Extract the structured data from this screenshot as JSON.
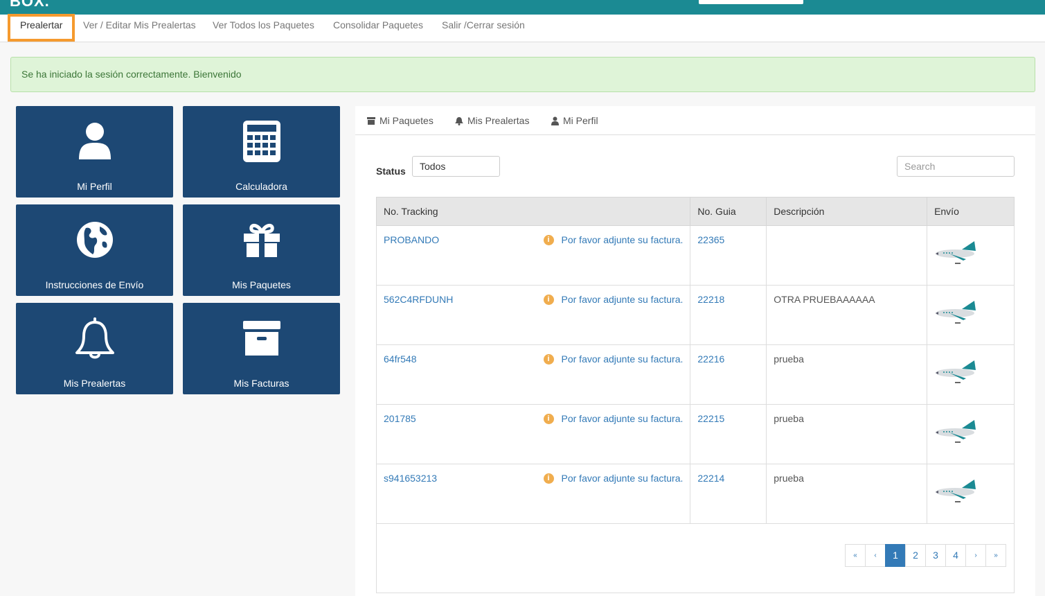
{
  "topbar": {
    "logo": "BOX."
  },
  "nav": {
    "items": [
      {
        "label": "Prealertar",
        "active": true
      },
      {
        "label": "Ver / Editar Mis Prealertas"
      },
      {
        "label": "Ver Todos los Paquetes"
      },
      {
        "label": "Consolidar Paquetes"
      },
      {
        "label": "Salir /Cerrar sesión"
      }
    ]
  },
  "alert": {
    "text": "Se ha iniciado la sesión correctamente. Bienvenido"
  },
  "tiles": [
    {
      "label": "Mi Perfil",
      "icon": "user-icon"
    },
    {
      "label": "Calculadora",
      "icon": "calculator-icon"
    },
    {
      "label": "Instrucciones de Envío",
      "icon": "globe-icon"
    },
    {
      "label": "Mis Paquetes",
      "icon": "gift-icon"
    },
    {
      "label": "Mis Prealertas",
      "icon": "bell-icon"
    },
    {
      "label": "Mis Facturas",
      "icon": "archive-icon"
    }
  ],
  "tabs": [
    {
      "label": "Mi Paquetes",
      "icon": "archive-icon"
    },
    {
      "label": "Mis Prealertas",
      "icon": "bell-icon"
    },
    {
      "label": "Mi Perfil",
      "icon": "user-icon"
    }
  ],
  "filters": {
    "status_label": "Status",
    "status_value": "Todos",
    "search_placeholder": "Search"
  },
  "table": {
    "headers": [
      "No. Tracking",
      "No. Guia",
      "Descripción",
      "Envío"
    ],
    "warning_text": "Por favor adjunte su factura.",
    "rows": [
      {
        "tracking": "PROBANDO",
        "guia": "22365",
        "descripcion": "",
        "envio": "airplane-icon"
      },
      {
        "tracking": "562C4RFDUNH",
        "guia": "22218",
        "descripcion": "OTRA PRUEBAAAAAA",
        "envio": "airplane-icon"
      },
      {
        "tracking": "64fr548",
        "guia": "22216",
        "descripcion": "prueba",
        "envio": "airplane-icon"
      },
      {
        "tracking": "201785",
        "guia": "22215",
        "descripcion": "prueba",
        "envio": "airplane-icon"
      },
      {
        "tracking": "s941653213",
        "guia": "22214",
        "descripcion": "prueba",
        "envio": "airplane-icon"
      }
    ]
  },
  "pagination": {
    "first": "«",
    "prev": "‹",
    "pages": [
      "1",
      "2",
      "3",
      "4"
    ],
    "current": "1",
    "next": "›",
    "last": "»"
  },
  "colors": {
    "topbar": "#1b8a93",
    "tile": "#1d4874",
    "link": "#337ab7",
    "highlight": "#f59a2e",
    "warning": "#f0ad4e"
  }
}
